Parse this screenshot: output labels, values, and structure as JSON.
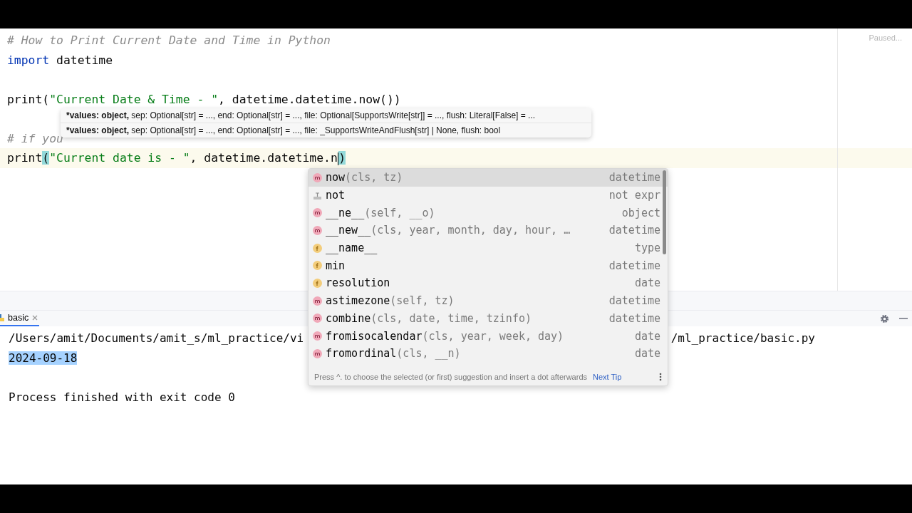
{
  "editor": {
    "status": "Paused...",
    "lines": [
      {
        "kind": "comment",
        "text": "# How to Print Current Date and Time in Python",
        "current": false
      },
      {
        "kind": "import",
        "keyword": "import",
        "text": "datetime",
        "current": false
      },
      {
        "kind": "blank",
        "current": false
      },
      {
        "kind": "call",
        "fn": "print(",
        "string": "\"Current Date & Time - \"",
        "rest": ", datetime.datetime.now())",
        "current": false
      },
      {
        "kind": "blank",
        "current": false
      },
      {
        "kind": "comment",
        "text": "# if you",
        "current": false
      },
      {
        "kind": "call",
        "fn": "print(",
        "string": "\"Current date is - \"",
        "rest": ", datetime.datetime.n)",
        "current": true
      }
    ]
  },
  "parameter_info": [
    {
      "bold": "*values: object,",
      "rest": " sep: Optional[str] = ..., end: Optional[str] = ..., file: Optional[SupportsWrite[str]] = ..., flush: Literal[False] = ..."
    },
    {
      "bold": "*values: object,",
      "rest": " sep: Optional[str] = ..., end: Optional[str] = ..., file: _SupportsWriteAndFlush[str] | None, flush: bool"
    }
  ],
  "completion": {
    "items": [
      {
        "kind": "method",
        "name": "now",
        "params": "(cls, tz)",
        "type": "datetime",
        "selected": true
      },
      {
        "kind": "keyword",
        "name": "not",
        "type": "not expr",
        "selected": false
      },
      {
        "kind": "method",
        "name": "__ne__",
        "params": "(self, __o)",
        "type": "object",
        "selected": false
      },
      {
        "kind": "method",
        "name": "__new__",
        "params": "(cls, year, month, day, hour, …",
        "type": "datetime",
        "selected": false
      },
      {
        "kind": "field",
        "name": "__name__",
        "type": "type",
        "selected": false
      },
      {
        "kind": "field",
        "name": "min",
        "type": "datetime",
        "selected": false
      },
      {
        "kind": "field",
        "name": "resolution",
        "type": "date",
        "selected": false
      },
      {
        "kind": "method",
        "name": "astimezone",
        "params": "(self, tz)",
        "type": "datetime",
        "selected": false
      },
      {
        "kind": "method",
        "name": "combine",
        "params": "(cls, date, time, tzinfo)",
        "type": "datetime",
        "selected": false
      },
      {
        "kind": "method",
        "name": "fromisocalendar",
        "params": "(cls, year, week, day)",
        "type": "date",
        "selected": false
      },
      {
        "kind": "method",
        "name": "fromordinal",
        "params": "(cls, __n)",
        "type": "date",
        "selected": false
      }
    ],
    "hint": "Press ^. to choose the selected (or first) suggestion and insert a dot afterwards",
    "next_tip": "Next Tip"
  },
  "run": {
    "tab": {
      "label": "basic",
      "selected": true
    },
    "path_start": "/Users/amit/Documents/amit_s/ml_practice/vi",
    "path_end": "/ml_practice/basic.py",
    "output": "2024-09-18",
    "output_selected": true,
    "exit": "Process finished with exit code 0"
  }
}
